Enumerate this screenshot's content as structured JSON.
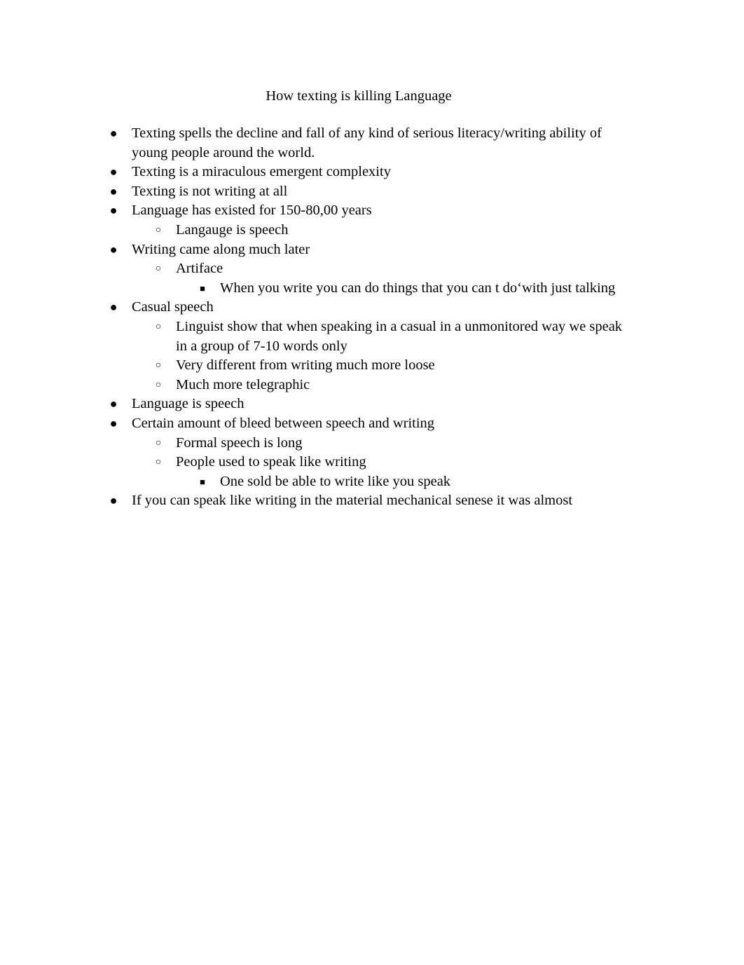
{
  "document": {
    "title": "How texting is killing Language",
    "bullets": {
      "level0": "●",
      "level1": "○",
      "level2": "■"
    },
    "items": [
      {
        "level": 0,
        "text": "Texting spells the decline and fall of any kind of serious literacy/writing ability of young people around the world."
      },
      {
        "level": 0,
        "text": "Texting is a miraculous emergent complexity"
      },
      {
        "level": 0,
        "text": "Texting is not writing at all"
      },
      {
        "level": 0,
        "text": "Language has existed for 150-80,00 years"
      },
      {
        "level": 1,
        "text": "Langauge is speech"
      },
      {
        "level": 0,
        "text": "Writing came along much later"
      },
      {
        "level": 1,
        "text": "Artiface"
      },
      {
        "level": 2,
        "text": "When you write you can do things that you can t do‘with just talking"
      },
      {
        "level": 0,
        "text": "Casual speech"
      },
      {
        "level": 1,
        "text": "Linguist show that when speaking in a casual in a unmonitored way we speak in a group of 7-10 words only"
      },
      {
        "level": 1,
        "text": "Very different from writing much more loose"
      },
      {
        "level": 1,
        "text": "Much more telegraphic"
      },
      {
        "level": 0,
        "text": "Language is speech"
      },
      {
        "level": 0,
        "text": "Certain amount of bleed between speech and writing"
      },
      {
        "level": 1,
        "text": "Formal speech is long"
      },
      {
        "level": 1,
        "text": "People used to speak like writing"
      },
      {
        "level": 2,
        "text": "One sold be able to write like you speak"
      },
      {
        "level": 0,
        "text": "If you can speak like writing in the material mechanical senese it was almost"
      }
    ]
  }
}
